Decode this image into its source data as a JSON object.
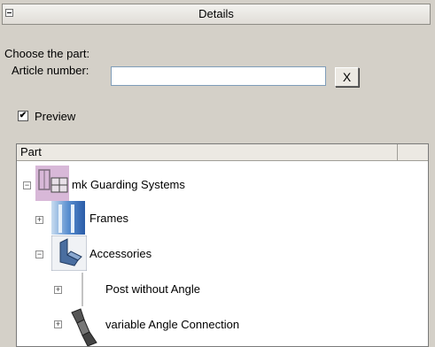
{
  "panel": {
    "title": "Details",
    "toggle_symbol": "−"
  },
  "form": {
    "choose_label": "Choose the part:",
    "article_label": "Article number:",
    "article_value": "",
    "clear_label": "X",
    "preview_label": "Preview",
    "preview_checked": true,
    "check_mark": "✔"
  },
  "tree": {
    "column_header": "Part",
    "items": [
      {
        "label": "mk Guarding Systems",
        "expander": "−",
        "icon": "guarding-systems-icon"
      },
      {
        "label": "Frames",
        "expander": "+",
        "icon": "frames-icon"
      },
      {
        "label": "Accessories",
        "expander": "−",
        "icon": "accessories-icon"
      },
      {
        "label": "Post without Angle",
        "expander": "+",
        "icon": "post-icon"
      },
      {
        "label": "variable Angle Connection",
        "expander": "+",
        "icon": "angle-connection-icon"
      }
    ]
  }
}
